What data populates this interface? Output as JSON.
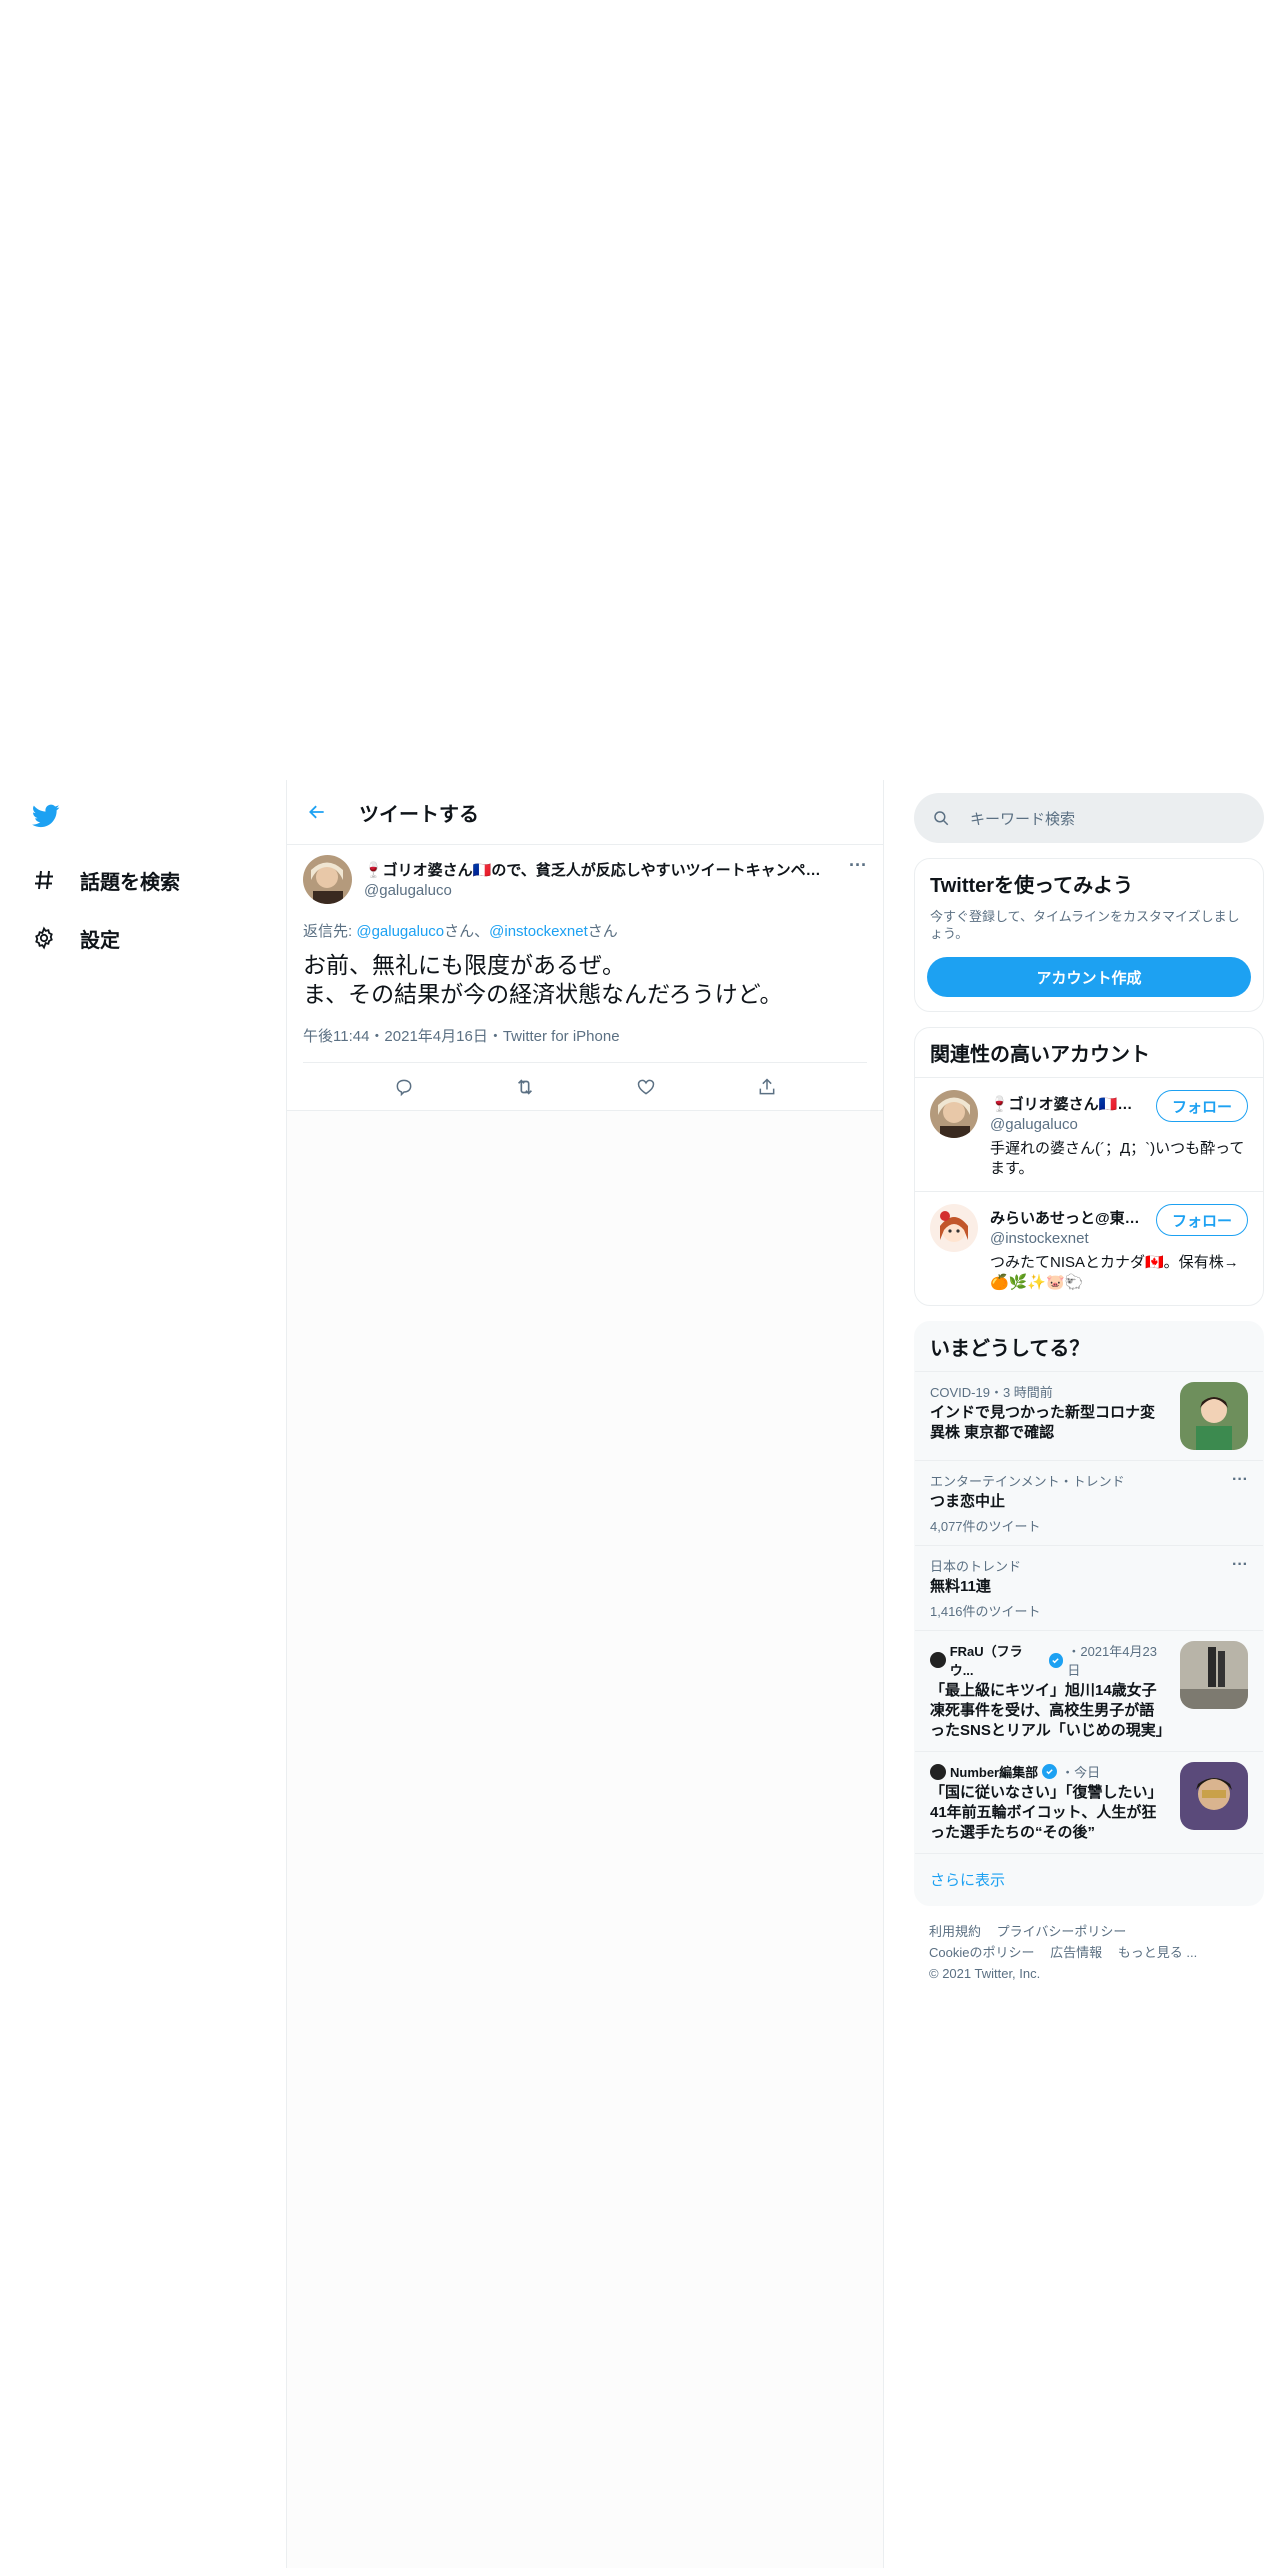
{
  "nav": {
    "items": [
      {
        "label": "話題を検索",
        "icon": "hashtag-icon"
      },
      {
        "label": "設定",
        "icon": "gear-icon"
      }
    ]
  },
  "header": {
    "title": "ツイートする"
  },
  "tweet": {
    "author_name": "🍷ゴリオ婆さん🇫🇷ので、貧乏人が反応しやすいツイートキャンペーン中",
    "author_handle": "@galugaluco",
    "reply_prefix": "返信先: ",
    "reply_user1": "@galugaluco",
    "reply_mid": "さん、",
    "reply_user2": "@instockexnet",
    "reply_suffix": "さん",
    "text_line1": "お前、無礼にも限度があるぜ。",
    "text_line2": "ま、その結果が今の経済状態なんだろうけど。",
    "meta": "午後11:44・2021年4月16日・Twitter for iPhone",
    "more": "···"
  },
  "search": {
    "placeholder": "キーワード検索"
  },
  "signup": {
    "title": "Twitterを使ってみよう",
    "desc": "今すぐ登録して、タイムラインをカスタマイズしましょう。",
    "button": "アカウント作成"
  },
  "related": {
    "title": "関連性の高いアカウント",
    "accounts": [
      {
        "name": "🍷ゴリオ婆さん🇫🇷ので、",
        "handle": "@galugaluco",
        "follow": "フォロー",
        "bio": "手遅れの婆さん(´；Д；`)いつも酔ってます。"
      },
      {
        "name": "みらいあせっと@東京暮らし",
        "handle": "@instockexnet",
        "follow": "フォロー",
        "bio": "つみたてNISAとカナダ🇨🇦。保有株→🍊🌿✨🐷🐑"
      }
    ]
  },
  "trends": {
    "title": "いまどうしてる？",
    "items": [
      {
        "context": "COVID-19・3 時間前",
        "title": "インドで見つかった新型コロナ変異株 東京都で確認",
        "count": ""
      },
      {
        "context": "エンターテインメント・トレンド",
        "title": "つま恋中止",
        "count": "4,077件のツイート"
      },
      {
        "context": "日本のトレンド",
        "title": "無料11連",
        "count": "1,416件のツイート"
      },
      {
        "source": "FRaU（フラウ...",
        "time": "・2021年4月23日",
        "title": "「最上級にキツイ」旭川14歳女子凍死事件を受け、高校生男子が語ったSNSとリアル「いじめの現実」"
      },
      {
        "source": "Number編集部",
        "time": "・今日",
        "title": "「国に従いなさい」「復讐したい」41年前五輪ボイコット、人生が狂った選手たちの“その後”"
      }
    ],
    "show_more": "さらに表示"
  },
  "footer": {
    "terms": "利用規約",
    "privacy": "プライバシーポリシー",
    "cookie": "Cookieのポリシー",
    "ads": "広告情報",
    "more": "もっと見る ...",
    "copyright": "© 2021 Twitter, Inc."
  },
  "colors": {
    "accent": "#1da1f2",
    "text": "#0f1419",
    "muted": "#5b7083"
  }
}
